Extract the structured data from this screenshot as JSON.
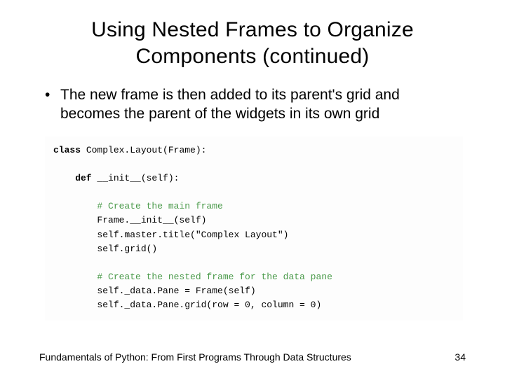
{
  "title": "Using Nested Frames to Organize Components (continued)",
  "bullet1": "The new frame is then added to its parent's grid and becomes the parent of the widgets in its own grid",
  "code": {
    "l1a": "class",
    "l1b": " Complex.Layout(Frame):",
    "l2a": "    def",
    "l2b": " __init__(self):",
    "l3": "        # Create the main frame",
    "l4": "        Frame.__init__(self)",
    "l5": "        self.master.title(\"Complex Layout\")",
    "l6": "        self.grid()",
    "l7": "        # Create the nested frame for the data pane",
    "l8": "        self._data.Pane = Frame(self)",
    "l9": "        self._data.Pane.grid(row = 0, column = 0)"
  },
  "footer_left": "Fundamentals of Python: From First Programs Through Data Structures",
  "footer_right": "34"
}
